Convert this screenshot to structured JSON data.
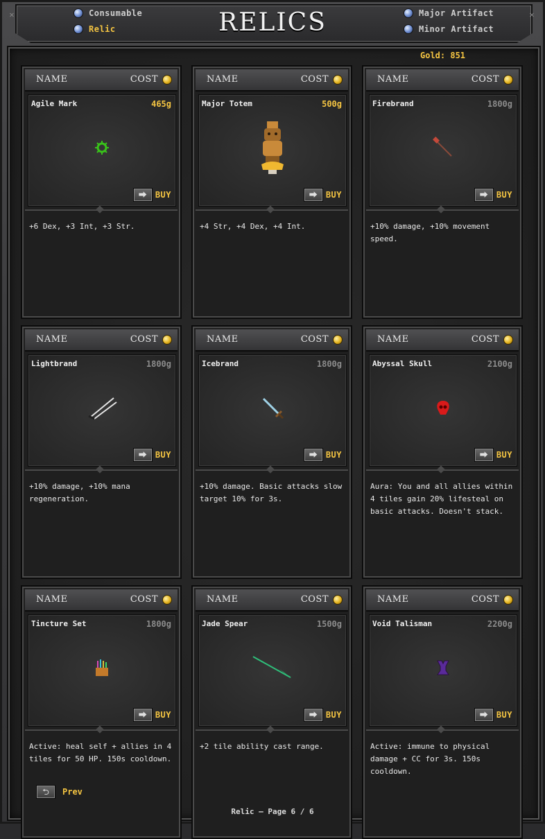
{
  "header": {
    "title": "RELICS",
    "categories_left": [
      {
        "label": "Consumable",
        "active": false
      },
      {
        "label": "Relic",
        "active": true
      }
    ],
    "categories_right": [
      {
        "label": "Major Artifact",
        "active": false
      },
      {
        "label": "Minor Artifact",
        "active": false
      }
    ],
    "gold": "Gold: 851"
  },
  "columns": {
    "name": "NAME",
    "cost": "COST"
  },
  "buy_label": "BUY",
  "items": [
    {
      "name": "Agile Mark",
      "cost": "465g",
      "affordable": true,
      "icon": "gear-gem-icon",
      "color": "#39c21a",
      "description": "+6 Dex, +3 Int, +3 Str."
    },
    {
      "name": "Major Totem",
      "cost": "500g",
      "affordable": true,
      "icon": "totem-icon",
      "color": "#c98a3a",
      "description": "+4 Str, +4 Dex, +4 Int."
    },
    {
      "name": "Firebrand",
      "cost": "1800g",
      "affordable": false,
      "icon": "fire-staff-icon",
      "color": "#c4493a",
      "description": "+10% damage, +10% movement speed."
    },
    {
      "name": "Lightbrand",
      "cost": "1800g",
      "affordable": false,
      "icon": "twin-blades-icon",
      "color": "#e6e6e6",
      "description": "+10% damage, +10% mana regeneration."
    },
    {
      "name": "Icebrand",
      "cost": "1800g",
      "affordable": false,
      "icon": "ice-sword-icon",
      "color": "#9fd2e6",
      "description": "+10% damage. Basic attacks slow target 10% for 3s."
    },
    {
      "name": "Abyssal Skull",
      "cost": "2100g",
      "affordable": false,
      "icon": "skull-icon",
      "color": "#d91a1a",
      "description": "Aura: You and all allies within 4 tiles gain 20% lifesteal on basic attacks. Doesn't stack."
    },
    {
      "name": "Tincture Set",
      "cost": "1800g",
      "affordable": false,
      "icon": "tincture-icon",
      "color": "#c47a2a",
      "description": "Active: heal self + allies in 4 tiles for 50 HP. 150s cooldown."
    },
    {
      "name": "Jade Spear",
      "cost": "1500g",
      "affordable": false,
      "icon": "spear-icon",
      "color": "#2fbf7a",
      "description": "+2 tile ability cast range."
    },
    {
      "name": "Void Talisman",
      "cost": "2200g",
      "affordable": false,
      "icon": "talisman-icon",
      "color": "#5a2a9a",
      "description": "Active: immune to physical damage + CC for 3s. 150s cooldown."
    }
  ],
  "prev_label": "Prev",
  "pager": {
    "category": "Relic",
    "page_text": "Page 6 / 6"
  }
}
